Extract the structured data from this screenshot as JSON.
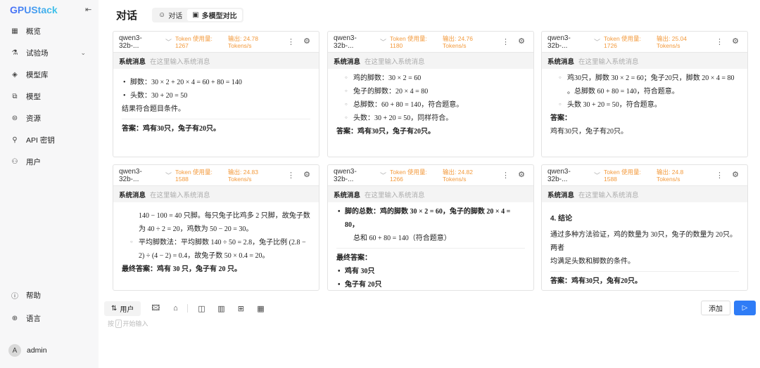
{
  "sidebar": {
    "logo": "GPUStack",
    "items": [
      {
        "label": "概览",
        "icon": "grid-icon"
      },
      {
        "label": "试验场",
        "icon": "flask-icon"
      },
      {
        "label": "模型库",
        "icon": "layers-icon"
      },
      {
        "label": "模型",
        "icon": "copy-icon"
      },
      {
        "label": "资源",
        "icon": "server-icon"
      },
      {
        "label": "API 密钥",
        "icon": "key-icon"
      },
      {
        "label": "用户",
        "icon": "users-icon"
      }
    ],
    "help": "帮助",
    "language": "语言",
    "user": {
      "initial": "A",
      "name": "admin"
    }
  },
  "header": {
    "title": "对话",
    "tabs": [
      {
        "label": "对话"
      },
      {
        "label": "多模型对比",
        "active": true
      }
    ]
  },
  "panels": [
    {
      "model": "qwen3-32b-...",
      "token_label": "Token 使用量:",
      "tokens": "1267",
      "speed_label": "输出: 24.78",
      "speed_unit": "Tokens/s",
      "sys_label": "系统消息",
      "sys_placeholder": "在这里输入系统消息",
      "lines": [
        "脚数：30 × 2 + 20 × 4 = 60 + 80 = 140",
        "头数：30 + 20 = 50",
        "结果符合题目条件。",
        "答案：鸡有30只，兔子有20只。"
      ]
    },
    {
      "model": "qwen3-32b-...",
      "token_label": "Token 使用量:",
      "tokens": "1180",
      "speed_label": "输出: 24.76",
      "speed_unit": "Tokens/s",
      "sys_label": "系统消息",
      "sys_placeholder": "在这里输入系统消息",
      "lines": [
        "鸡的脚数：30 × 2 = 60",
        "兔子的脚数：20 × 4 = 80",
        "总脚数：60 + 80 = 140，符合题意。",
        "头数：30 + 20 = 50，同样符合。",
        "答案：鸡有30只，兔子有20只。"
      ]
    },
    {
      "model": "qwen3-32b-...",
      "token_label": "Token 使用量:",
      "tokens": "1726",
      "speed_label": "输出: 25.04",
      "speed_unit": "Tokens/s",
      "sys_label": "系统消息",
      "sys_placeholder": "在这里输入系统消息",
      "lines": [
        "鸡30只，脚数 30 × 2 = 60；兔子20只，脚数 20 × 4 = 80",
        "。总脚数 60 + 80 = 140，符合题意。",
        "头数 30 + 20 = 50，符合题意。",
        "答案：",
        "鸡有30只，兔子有20只。"
      ]
    },
    {
      "model": "qwen3-32b-...",
      "token_label": "Token 使用量:",
      "tokens": "1588",
      "speed_label": "输出: 24.83",
      "speed_unit": "Tokens/s",
      "sys_label": "系统消息",
      "sys_placeholder": "在这里输入系统消息",
      "lines": [
        "140 − 100 = 40 只脚。每只兔子比鸡多 2 只脚，故兔子数",
        "为 40 ÷ 2 = 20，鸡数为 50 − 20 = 30。",
        "平均脚数法：平均脚数 140 ÷ 50 = 2.8，兔子比例 (2.8 −",
        "2) ÷ (4 − 2) = 0.4，故兔子数 50 × 0.4 = 20。",
        "最终答案：鸡有 30 只，兔子有 20 只。"
      ]
    },
    {
      "model": "qwen3-32b-...",
      "token_label": "Token 使用量:",
      "tokens": "1266",
      "speed_label": "输出: 24.82",
      "speed_unit": "Tokens/s",
      "sys_label": "系统消息",
      "sys_placeholder": "在这里输入系统消息",
      "lines": [
        "脚的总数：鸡的脚数 30 × 2 = 60，兔子的脚数 20 × 4 = 80，",
        "总和 60 + 80 = 140（符合题意）",
        "最终答案：",
        "鸡有 30只",
        "兔子有 20只"
      ]
    },
    {
      "model": "qwen3-32b-...",
      "token_label": "Token 使用量:",
      "tokens": "1588",
      "speed_label": "输出: 24.8",
      "speed_unit": "Tokens/s",
      "sys_label": "系统消息",
      "sys_placeholder": "在这里输入系统消息",
      "lines": [
        "4. 结论",
        "通过多种方法验证，鸡的数量为 30只，兔子的数量为 20只。两者",
        "均满足头数和脚数的条件。",
        "答案：鸡有30只，兔有20只。"
      ]
    }
  ],
  "composer": {
    "role": "用户",
    "add": "添加",
    "hint_pre": "按",
    "hint_key": "/",
    "hint_post": "开始输入"
  },
  "colors": {
    "accent": "#2f7cf6",
    "stats": "#f39a3c"
  }
}
